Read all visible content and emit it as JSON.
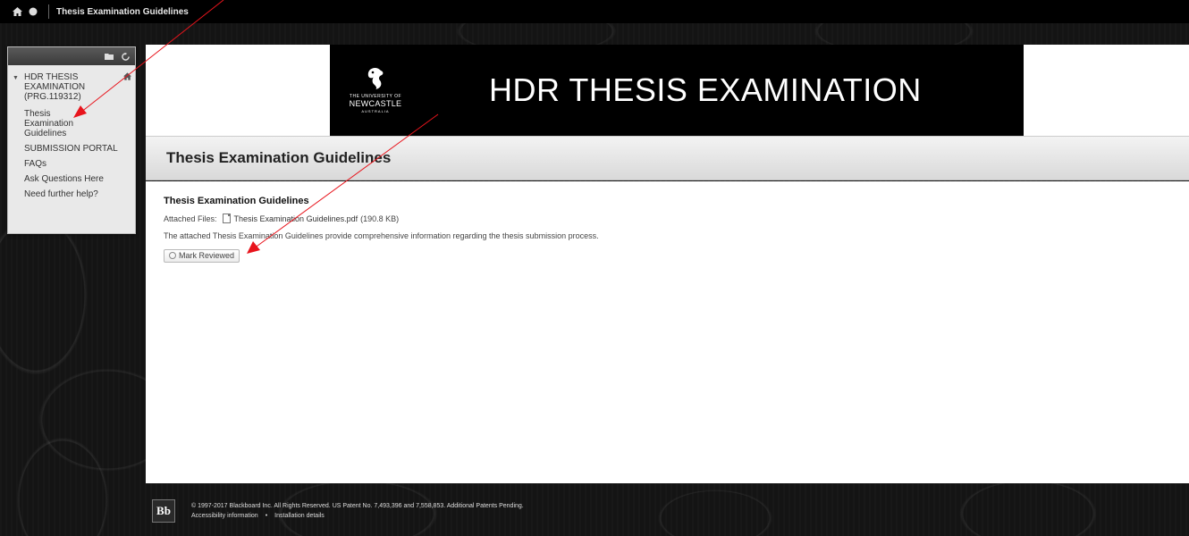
{
  "topbar": {
    "title": "Thesis Examination Guidelines",
    "icons": [
      "home-icon",
      "circle-icon"
    ]
  },
  "menu": {
    "toolbar_icons": [
      "folder-icon",
      "refresh-icon"
    ],
    "course_title": "HDR THESIS EXAMINATION (PRG.119312)",
    "items": [
      {
        "label": "Thesis Examination Guidelines"
      },
      {
        "label": "SUBMISSION PORTAL"
      },
      {
        "label": "FAQs"
      },
      {
        "label": "Ask Questions Here"
      },
      {
        "label": "Need further help?"
      }
    ]
  },
  "banner": {
    "logo_small": "THE UNIVERSITY OF",
    "logo_name": "NEWCASTLE",
    "logo_sub": "AUSTRALIA",
    "title": "HDR THESIS EXAMINATION"
  },
  "page": {
    "title": "Thesis Examination Guidelines"
  },
  "item": {
    "title": "Thesis Examination Guidelines",
    "attached_label": "Attached Files:",
    "file_name": "Thesis Examination Guidelines.pdf",
    "file_size": "(190.8 KB)",
    "description": "The attached Thesis Examination Guidelines provide comprehensive information regarding the thesis submission process.",
    "mark_reviewed_label": "Mark Reviewed"
  },
  "footer": {
    "logo": "Bb",
    "copyright": "© 1997-2017 Blackboard Inc. All Rights Reserved. US Patent No. 7,493,396 and 7,558,853. Additional Patents Pending.",
    "accessibility_link": "Accessibility information",
    "bullet": "•",
    "installation_link": "Installation details"
  },
  "annotation": {
    "arrow_color": "#e8141c"
  }
}
